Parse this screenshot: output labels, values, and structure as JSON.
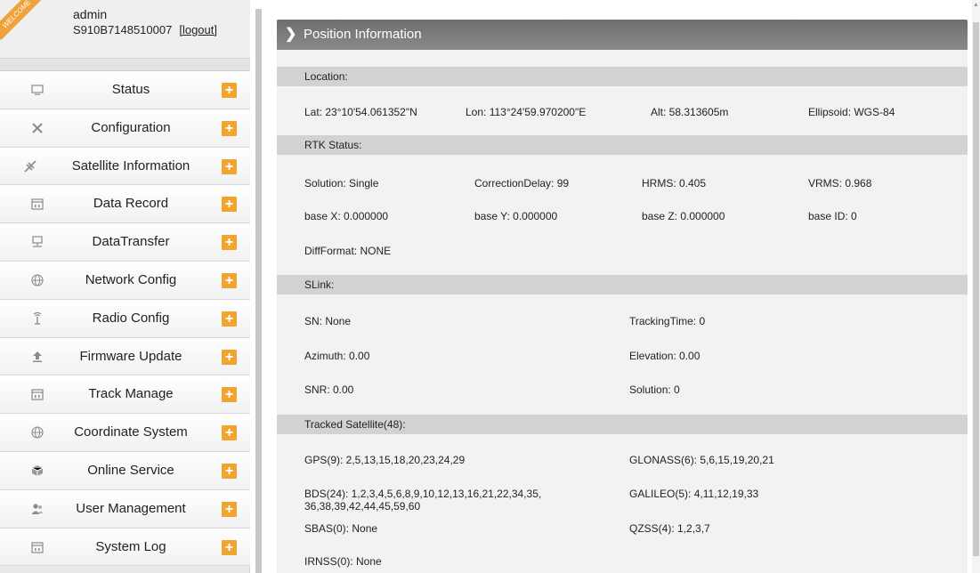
{
  "user": {
    "welcome": "WELCOME",
    "name": "admin",
    "serial": "S910B7148510007",
    "logout": "[logout]"
  },
  "menu": [
    {
      "label": "Status",
      "icon": "monitor-icon"
    },
    {
      "label": "Configuration",
      "icon": "tools-icon"
    },
    {
      "label": "Satellite Information",
      "icon": "satellite-icon"
    },
    {
      "label": "Data Record",
      "icon": "calendar-icon"
    },
    {
      "label": "DataTransfer",
      "icon": "network-icon"
    },
    {
      "label": "Network Config",
      "icon": "globe-icon"
    },
    {
      "label": "Radio Config",
      "icon": "radio-antenna-icon"
    },
    {
      "label": "Firmware Update",
      "icon": "upload-icon"
    },
    {
      "label": "Track Manage",
      "icon": "calendar-icon"
    },
    {
      "label": "Coordinate System",
      "icon": "globe-icon"
    },
    {
      "label": "Online Service",
      "icon": "cube-icon"
    },
    {
      "label": "User Management",
      "icon": "users-icon"
    },
    {
      "label": "System Log",
      "icon": "calendar-icon"
    }
  ],
  "menu_plus": "+",
  "main": {
    "title": "Position Information",
    "location": {
      "heading": "Location:",
      "lat": "Lat:  23°10'54.061352\"N",
      "lon": "Lon:  113°24'59.970200\"E",
      "alt": "Alt:  58.313605m",
      "ellipsoid": "Ellipsoid:  WGS-84"
    },
    "rtk": {
      "heading": "RTK Status:",
      "solution": "Solution:  Single",
      "correction_delay": "CorrectionDelay:  99",
      "hrms": "HRMS:  0.405",
      "vrms": "VRMS:  0.968",
      "base_x": "base X:  0.000000",
      "base_y": "base Y:  0.000000",
      "base_z": "base Z:  0.000000",
      "base_id": "base ID:  0",
      "diff_format": "DiffFormat:  NONE"
    },
    "slink": {
      "heading": "SLink:",
      "sn": "SN:  None",
      "tracking_time": "TrackingTime:  0",
      "azimuth": "Azimuth:  0.00",
      "elevation": "Elevation:  0.00",
      "snr": "SNR:  0.00",
      "solution": "Solution:  0"
    },
    "satellites": {
      "heading": "Tracked Satellite(48):",
      "gps": "GPS(9):  2,5,13,15,18,20,23,24,29",
      "glonass": "GLONASS(6):  5,6,15,19,20,21",
      "bds_line1": "BDS(24):  1,2,3,4,5,6,8,9,10,12,13,16,21,22,34,35,",
      "bds_line2": "36,38,39,42,44,45,59,60",
      "galileo": "GALILEO(5):  4,11,12,19,33",
      "sbas": "SBAS(0):  None",
      "qzss": "QZSS(4):  1,2,3,7",
      "irnss": "IRNSS(0):  None"
    }
  }
}
